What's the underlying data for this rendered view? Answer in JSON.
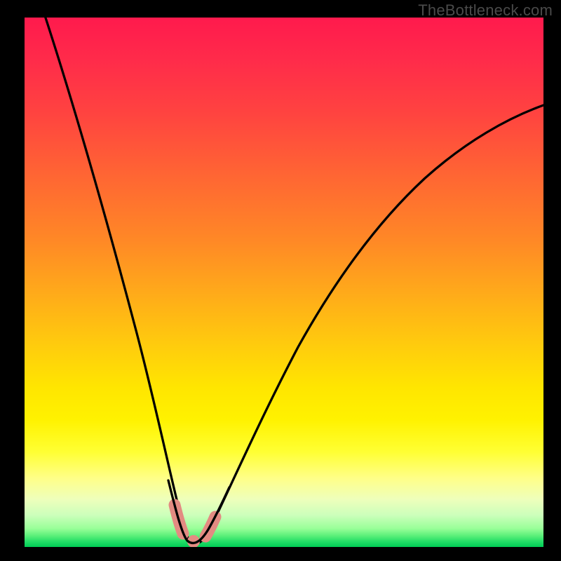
{
  "watermark": "TheBottleneck.com",
  "colors": {
    "frame": "#000000",
    "gradient_top": "#ff1a4d",
    "gradient_bottom": "#00cc55",
    "curve": "#000000",
    "marker": "#e38b82"
  },
  "chart_data": {
    "type": "line",
    "title": "",
    "xlabel": "",
    "ylabel": "",
    "xlim": [
      0,
      100
    ],
    "ylim": [
      0,
      100
    ],
    "grid": false,
    "legend": false,
    "background_gradient": "red→orange→yellow→green (top to bottom)",
    "series": [
      {
        "name": "bottleneck-curve",
        "x": [
          0,
          4,
          8,
          12,
          16,
          20,
          24,
          26,
          28,
          30,
          31,
          32,
          33,
          34,
          36,
          40,
          45,
          50,
          55,
          60,
          65,
          70,
          75,
          80,
          85,
          90,
          95,
          100
        ],
        "values": [
          104,
          91,
          77,
          63,
          49,
          35,
          20,
          12,
          6,
          2,
          1,
          0,
          0,
          1,
          3,
          11,
          22,
          32,
          40,
          47,
          53,
          59,
          64,
          68,
          72,
          76,
          79,
          82
        ]
      }
    ],
    "markers": [
      {
        "name": "left-segment-top",
        "x": 28.5,
        "y": 5.5
      },
      {
        "name": "left-segment-bottom",
        "x": 30.0,
        "y": 1.5
      },
      {
        "name": "bottom-point",
        "x": 32.0,
        "y": 0.3
      },
      {
        "name": "right-segment-bottom",
        "x": 34.5,
        "y": 1.8
      },
      {
        "name": "right-segment-top",
        "x": 36.0,
        "y": 4.0
      }
    ],
    "notes": "V-shaped bottleneck curve. No visible axis labels or tick marks. Values estimated from plot geometry; minimum sits near x≈32, y≈0."
  }
}
